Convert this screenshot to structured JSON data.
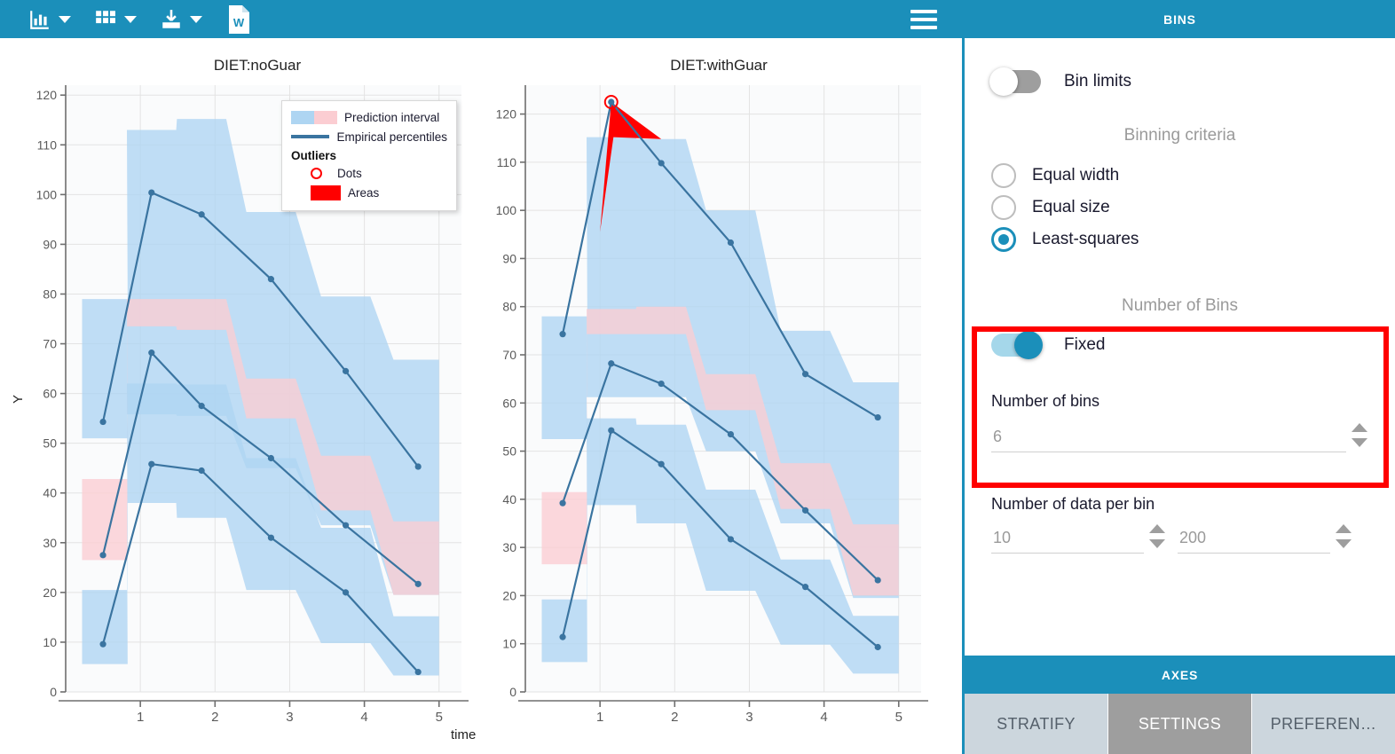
{
  "toolbar": {
    "items": [
      {
        "icon": "bar-chart-icon",
        "has_caret": true
      },
      {
        "icon": "grid-icon",
        "has_caret": true
      },
      {
        "icon": "download-icon",
        "has_caret": true
      },
      {
        "icon": "word-document-icon",
        "has_caret": false
      }
    ],
    "menu_icon": "hamburger-menu-icon",
    "word_icon_letter": "W"
  },
  "legend": {
    "prediction_interval": "Prediction interval",
    "empirical_percentiles": "Empirical percentiles",
    "outliers_header": "Outliers",
    "dots": "Dots",
    "areas": "Areas"
  },
  "axes": {
    "x_label": "time",
    "y_label": "Y"
  },
  "panel": {
    "bins_header": "BINS",
    "bin_limits_label": "Bin limits",
    "bin_limits_on": false,
    "binning_criteria_caption": "Binning criteria",
    "criteria": [
      {
        "label": "Equal width",
        "selected": false
      },
      {
        "label": "Equal size",
        "selected": false
      },
      {
        "label": "Least-squares",
        "selected": true
      }
    ],
    "number_of_bins_caption": "Number of Bins",
    "fixed_label": "Fixed",
    "fixed_on": true,
    "number_of_bins_label": "Number of bins",
    "number_of_bins_value": "6",
    "number_of_data_per_bin_label": "Number of data per bin",
    "data_per_bin_min": "10",
    "data_per_bin_max": "200",
    "axes_header": "AXES",
    "tabs": [
      {
        "label": "STRATIFY",
        "active": false
      },
      {
        "label": "SETTINGS",
        "active": true
      },
      {
        "label": "PREFEREN…",
        "active": false
      }
    ]
  },
  "colors": {
    "brand_blue": "#1b8fba",
    "prediction_blue": "#aed5f2",
    "prediction_pink": "#fbcdd2",
    "percentile_line": "#3a74a0",
    "outlier_red": "#ff0000",
    "tab_inactive": "#ccd6dd",
    "tab_active": "#9e9e9e"
  },
  "chart_data": [
    {
      "type": "line",
      "title": "DIET:noGuar",
      "xlabel": "time",
      "ylabel": "Y",
      "xlim": [
        0,
        5.3
      ],
      "ylim": [
        0,
        122
      ],
      "xticks": [
        1,
        2,
        3,
        4,
        5
      ],
      "yticks": [
        0,
        10,
        20,
        30,
        40,
        50,
        60,
        70,
        80,
        90,
        100,
        110,
        120
      ],
      "grid": true,
      "x": [
        0.5,
        1.15,
        1.82,
        2.75,
        3.75,
        4.72
      ],
      "series": [
        {
          "name": "upper percentile",
          "values": [
            54.3,
            100.4,
            96.0,
            83.0,
            64.5,
            45.3
          ]
        },
        {
          "name": "median percentile",
          "values": [
            27.5,
            68.2,
            57.5,
            47.0,
            33.5,
            21.7
          ]
        },
        {
          "name": "lower percentile",
          "values": [
            9.6,
            45.8,
            44.5,
            31.0,
            20.0,
            4.0
          ]
        }
      ],
      "bands": [
        {
          "name": "prediction interval upper (blue)",
          "color": "#aed5f2",
          "upper": [
            79.0,
            113.0,
            115.2,
            96.5,
            79.5,
            66.8
          ],
          "lower": [
            51.0,
            55.8,
            55.5,
            45.0,
            33.5,
            19.5
          ]
        },
        {
          "name": "prediction interval median (pink)",
          "color": "#fbcdd2",
          "upper": [
            42.8,
            79.0,
            79.0,
            63.0,
            47.5,
            34.3
          ],
          "lower": [
            26.5,
            73.5,
            72.8,
            55.0,
            36.5,
            19.5
          ]
        },
        {
          "name": "prediction interval lower (blue)",
          "color": "#aed5f2",
          "upper": [
            20.5,
            62.0,
            61.8,
            47.0,
            33.0,
            15.2
          ],
          "lower": [
            5.6,
            38.0,
            35.0,
            20.5,
            9.8,
            3.3
          ]
        }
      ],
      "outlier_dots": [],
      "outlier_areas": []
    },
    {
      "type": "line",
      "title": "DIET:withGuar",
      "xlabel": "time",
      "ylabel": "Y",
      "xlim": [
        0,
        5.3
      ],
      "ylim": [
        0,
        126
      ],
      "xticks": [
        1,
        2,
        3,
        4,
        5
      ],
      "yticks": [
        0,
        10,
        20,
        30,
        40,
        50,
        60,
        70,
        80,
        90,
        100,
        110,
        120
      ],
      "grid": true,
      "x": [
        0.5,
        1.15,
        1.82,
        2.75,
        3.75,
        4.72
      ],
      "series": [
        {
          "name": "upper percentile",
          "values": [
            74.3,
            122.5,
            109.8,
            93.3,
            66.0,
            57.0
          ]
        },
        {
          "name": "median percentile",
          "values": [
            39.2,
            68.2,
            64.0,
            53.5,
            37.7,
            23.2
          ]
        },
        {
          "name": "lower percentile",
          "values": [
            11.4,
            54.3,
            47.3,
            31.7,
            21.8,
            9.3
          ]
        }
      ],
      "bands": [
        {
          "name": "prediction interval upper (blue)",
          "color": "#aed5f2",
          "upper": [
            78.0,
            115.2,
            114.8,
            100.0,
            75.0,
            64.3
          ],
          "lower": [
            52.5,
            61.2,
            61.2,
            50.0,
            35.0,
            19.5
          ]
        },
        {
          "name": "prediction interval median (pink)",
          "color": "#fbcdd2",
          "upper": [
            41.5,
            79.5,
            80.0,
            66.0,
            47.5,
            34.8
          ],
          "lower": [
            26.5,
            74.3,
            74.3,
            58.5,
            38.0,
            20.0
          ]
        },
        {
          "name": "prediction interval lower (blue)",
          "color": "#aed5f2",
          "upper": [
            19.2,
            56.8,
            55.5,
            42.0,
            27.5,
            15.8
          ],
          "lower": [
            6.2,
            38.8,
            35.0,
            21.0,
            9.8,
            3.8
          ]
        }
      ],
      "outlier_dots": [
        {
          "x": 1.15,
          "y": 122.5
        }
      ],
      "outlier_areas": [
        {
          "points": [
            [
              1.15,
              122.5
            ],
            [
              1.0,
              95.5
            ],
            [
              1.18,
              115.2
            ],
            [
              1.82,
              114.8
            ]
          ]
        }
      ]
    }
  ]
}
